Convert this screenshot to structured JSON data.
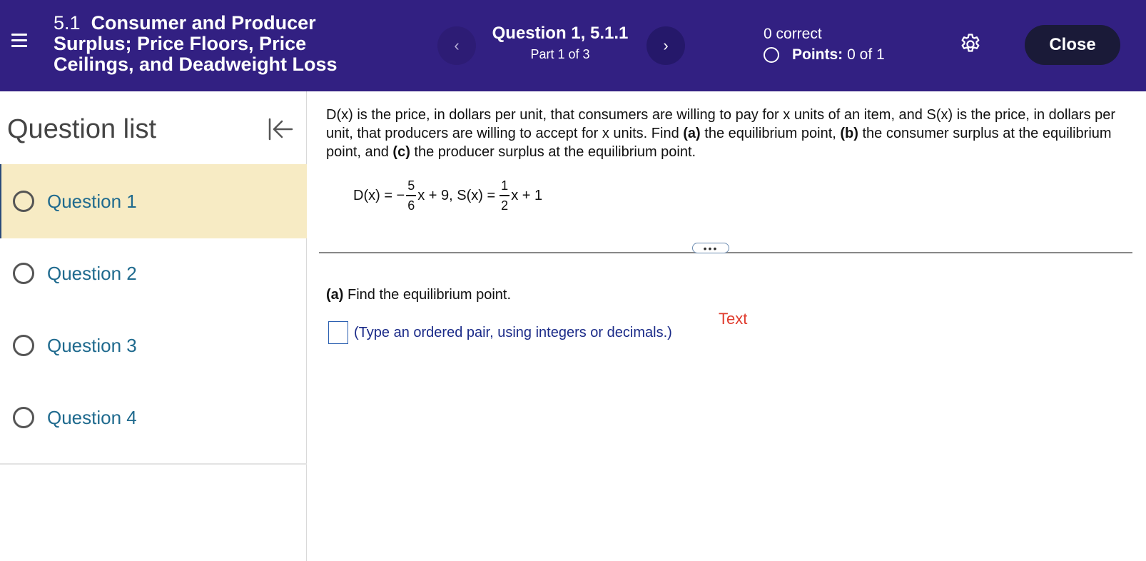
{
  "header": {
    "section_number": "5.1",
    "section_title": "Consumer and Producer Surplus; Price Floors, Price Ceilings, and Deadweight Loss",
    "prev_icon": "‹",
    "next_icon": "›",
    "question_title": "Question 1, 5.1.1",
    "question_part": "Part 1 of 3",
    "correct_text": "0 correct",
    "points_label": "Points:",
    "points_value": "0 of 1",
    "close_label": "Close",
    "colors": {
      "background": "#322082",
      "close_button": "#1a1a38"
    },
    "icons": [
      "hamburger-menu-icon",
      "chevron-left-icon",
      "chevron-right-icon",
      "points-circle-icon",
      "gear-icon"
    ]
  },
  "sidebar": {
    "title": "Question list",
    "collapse_icon": "collapse-left-icon",
    "active_color": "#f7ebc4",
    "items": [
      {
        "label": "Question 1",
        "active": true
      },
      {
        "label": "Question 2",
        "active": false
      },
      {
        "label": "Question 3",
        "active": false
      },
      {
        "label": "Question 4",
        "active": false
      }
    ]
  },
  "main": {
    "prompt_parts": [
      "D(x) is the price, in dollars per unit, that consumers are willing to pay for x units of an item, and S(x) is the price, in dollars per unit, that producers are willing to accept for x units. Find ",
      "(a)",
      " the equilibrium point, ",
      "(b)",
      " the consumer surplus at the equilibrium point, and ",
      "(c)",
      " the producer surplus at the equilibrium point."
    ],
    "equation": {
      "d_lhs": "D(x) = −",
      "d_num": "5",
      "d_den": "6",
      "d_rest": "x + 9, S(x) =",
      "s_num": "1",
      "s_den": "2",
      "s_rest": "x + 1"
    },
    "more_label": "•••",
    "part_a_label": "(a)",
    "part_a_text": " Find the equilibrium point.",
    "answer_hint": "(Type an ordered pair, using integers or decimals.)",
    "floating_text": "Text",
    "colors": {
      "hint": "#1a2a88",
      "floating_text": "#e03c2e",
      "question_link": "#1f6a8e"
    }
  }
}
